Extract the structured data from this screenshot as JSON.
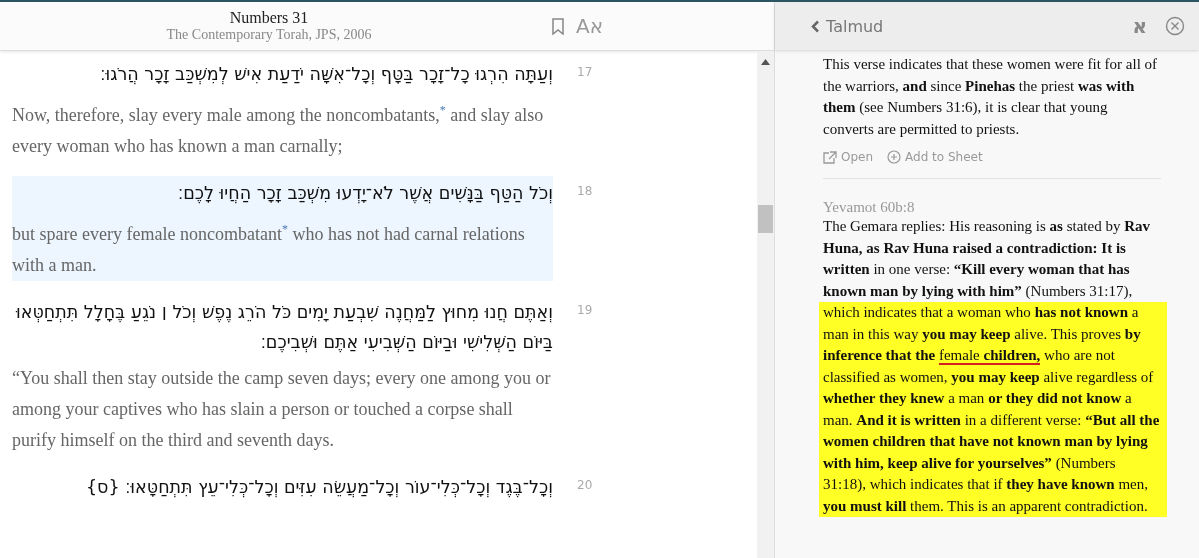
{
  "reader": {
    "title": "Numbers 31",
    "subtitle": "The Contemporary Torah, JPS, 2006",
    "text_size_button": "Aא",
    "verses": [
      {
        "number": "17",
        "hebrew": "וְעַתָּה הִרְגוּ כָל־זָכָר בַּטָּף וְכָל־אִשָּׁה יֹדַעַת אִישׁ לְמִשְׁכַּב זָכָר הֲרֹגוּ׃",
        "english": "Now, therefore, slay every male among the noncombatants,$^{*}$ and slay also every woman who has known a man carnally;",
        "selected": false
      },
      {
        "number": "18",
        "hebrew": "וְכֹל הַטַּף בַּנָּשִׁים אֲשֶׁר לֹא־יָדְעוּ מִשְׁכַּב זָכָר הַחֲיוּ לָכֶם׃",
        "english": "but spare every female noncombatant$^{*}$ who has not had carnal relations with a man.",
        "selected": true
      },
      {
        "number": "19",
        "hebrew": "וְאַתֶּם חֲנוּ מִחוּץ לַמַּחֲנֶה שִׁבְעַת יָמִים כֹּל הֹרֵג נֶפֶשׁ וְכֹל ׀ נֹגֵעַ בֶּחָלָל תִּתְחַטְּאוּ בַּיּוֹם הַשְּׁלִישִׁי וּבַיּוֹם הַשְּׁבִיעִי אַתֶּם וּשְׁבִיכֶם׃",
        "english": "“You shall then stay outside the camp seven days; every one among you or among your captives who has slain a person or touched a corpse shall purify himself on the third and seventh days.",
        "selected": false
      },
      {
        "number": "20",
        "hebrew": "וְכָל־בֶּגֶד וְכָל־כְּלִי־עוֹר וְכָל־מַעֲשֵׂה עִזִּים וְכָל־כְּלִי־עֵץ תִּתְחַטָּאוּ׃ {ס}",
        "selected": false
      }
    ]
  },
  "connections": {
    "back_label": "Talmud",
    "language_toggle": "א",
    "entries": [
      {
        "segments": [
          {
            "text": "This verse indicates that these women were fit for all of the warriors, **and** since **Pinehas** the priest **was with them** (see Numbers 31:6), it is clear that young converts are permitted to priests.",
            "highlighted": false
          }
        ],
        "actions": [
          "Open",
          "Add to Sheet"
        ]
      },
      {
        "source": "Yevamot 60b:8",
        "segments": [
          {
            "text": "The Gemara replies: His reasoning is **as** stated by **Rav Huna, as Rav Huna raised a contradiction: It is written** in one verse: **“Kill every woman that has known man by lying with him”** (Numbers 31:17),",
            "highlighted": false
          },
          {
            "highlighted": true,
            "runs": [
              {
                "text": "which indicates that a woman who **has not known** a man in this way **you may keep** alive. This proves **by inference that the** ",
                "underlined": false
              },
              {
                "text": "female **children,**",
                "underlined": true
              },
              {
                "text": " who are not classified as women, **you may keep** alive regardless of **whether they knew** a man **or they did not know** a man. **And it is written** in a different verse: **“But all the women children that have not known man by lying with him, keep alive for yourselves”** (Numbers 31:18), which indicates that if **they have known** men, **you must kill** them. This is an apparent contradiction.",
                "underlined": false
              }
            ]
          }
        ]
      }
    ]
  }
}
